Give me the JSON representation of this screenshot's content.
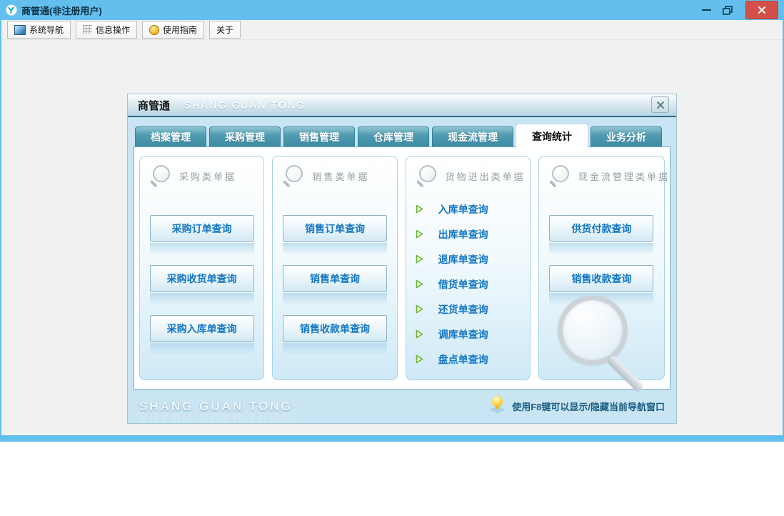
{
  "window": {
    "title": "商管通(非注册用户)",
    "controls": {
      "minimize_icon": "minimize-icon",
      "restore_icon": "restore-icon",
      "close_icon": "close-icon"
    }
  },
  "toolbar": {
    "items": [
      {
        "label": "系统导航",
        "icon": "system-nav-icon"
      },
      {
        "label": "信息操作",
        "icon": "info-grid-icon"
      },
      {
        "label": "使用指南",
        "icon": "guide-coin-icon"
      },
      {
        "label": "关于",
        "icon": null
      }
    ]
  },
  "panel": {
    "title_cn": "商管通",
    "title_en": "SHANG GUAN TONG",
    "close_icon": "close-icon",
    "tabs": [
      {
        "label": "档案管理",
        "active": false
      },
      {
        "label": "采购管理",
        "active": false
      },
      {
        "label": "销售管理",
        "active": false
      },
      {
        "label": "仓库管理",
        "active": false
      },
      {
        "label": "现金流管理",
        "active": false
      },
      {
        "label": "查询统计",
        "active": true
      },
      {
        "label": "业务分析",
        "active": false
      }
    ],
    "cards": [
      {
        "title": "采购类单据",
        "icon": "magnifier-icon",
        "item_type": "button",
        "items": [
          "采购订单查询",
          "采购收货单查询",
          "采购入库单查询"
        ],
        "magnifier_graphic": false
      },
      {
        "title": "销售类单据",
        "icon": "magnifier-icon",
        "item_type": "button",
        "items": [
          "销售订单查询",
          "销售单查询",
          "销售收款单查询"
        ],
        "magnifier_graphic": false
      },
      {
        "title": "货物进出类单据",
        "icon": "magnifier-icon",
        "item_type": "link",
        "items": [
          "入库单查询",
          "出库单查询",
          "退库单查询",
          "借货单查询",
          "还货单查询",
          "调库单查询",
          "盘点单查询"
        ],
        "magnifier_graphic": false
      },
      {
        "title": "现金流管理类单据",
        "icon": "magnifier-icon",
        "item_type": "button",
        "items": [
          "供货付款查询",
          "销售收款查询"
        ],
        "magnifier_graphic": true
      }
    ],
    "footer": {
      "watermark": "SHANG GUAN TONG",
      "bulb_icon": "lightbulb-icon",
      "hint": "使用F8键可以显示/隐藏当前导航窗口"
    }
  },
  "colors": {
    "titlebar_blue": "#63c0ee",
    "close_button_red": "#d25048",
    "tab_teal": "#4796ae",
    "active_tab_bg": "#ffffff",
    "action_blue": "#1377c5",
    "arrow_green": "#6ab42f",
    "panel_body_blue": "#c9e4f2",
    "hint_text_blue": "#1b5e83",
    "card_title_gray": "#989ea2"
  }
}
